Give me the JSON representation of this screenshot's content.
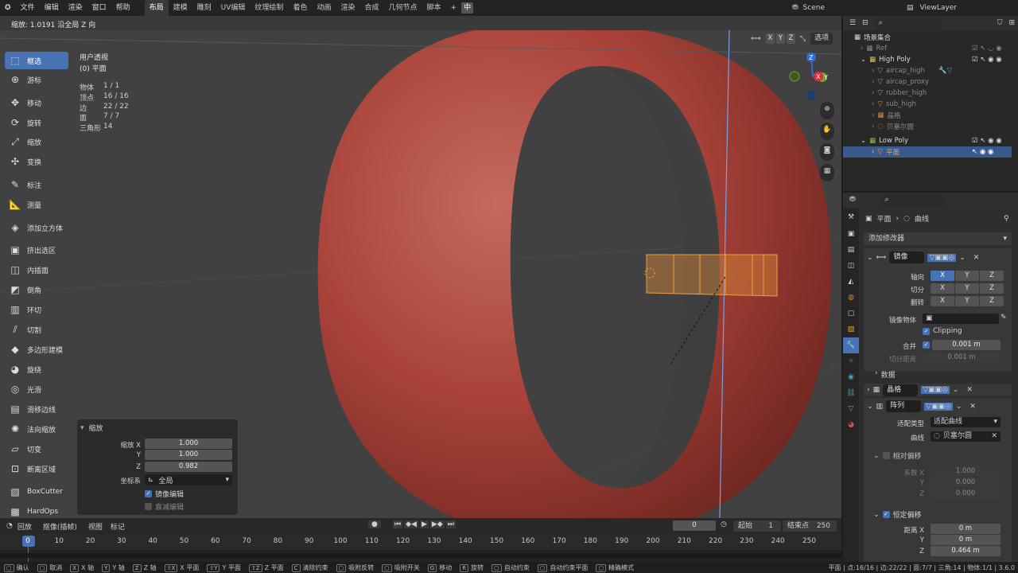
{
  "topbar": {
    "menus": [
      "文件",
      "编辑",
      "渲染",
      "窗口",
      "帮助"
    ],
    "workspaces": [
      "布局",
      "建模",
      "雕刻",
      "UV编辑",
      "纹理绘制",
      "着色",
      "动画",
      "渲染",
      "合成",
      "几何节点",
      "脚本"
    ],
    "active_workspace": "布局",
    "lang_button": "中",
    "scene_label": "Scene",
    "viewlayer_label": "ViewLayer"
  },
  "header": {
    "status_text": "缩放: 1.0191 沿全局 Z 向"
  },
  "viewport": {
    "view_name": "用户透视",
    "object_name": "(0) 平面",
    "stats": [
      {
        "k": "物体",
        "v": "1 / 1"
      },
      {
        "k": "顶点",
        "v": "16 / 16"
      },
      {
        "k": "边",
        "v": "22 / 22"
      },
      {
        "k": "面",
        "v": "7 / 7"
      },
      {
        "k": "三角形",
        "v": "14"
      }
    ],
    "xyz": [
      "X",
      "Y",
      "Z"
    ],
    "options_label": "选项",
    "gizmo": {
      "z": "Z",
      "x": "X",
      "y": "Y"
    }
  },
  "tools": [
    "框选",
    "游标",
    "移动",
    "旋转",
    "缩放",
    "变换",
    "标注",
    "测量",
    "添加立方体",
    "挤出选区",
    "内插面",
    "倒角",
    "环切",
    "切割",
    "多边形建模",
    "旋绕",
    "光滑",
    "滑移边线",
    "法向缩放",
    "切变",
    "断离区域",
    "BoxCutter",
    "HardOps"
  ],
  "redo_panel": {
    "title": "缩放",
    "rows": [
      {
        "label": "缩放 X",
        "value": "1.000"
      },
      {
        "label": "Y",
        "value": "1.000"
      },
      {
        "label": "Z",
        "value": "0.982"
      }
    ],
    "coord_label": "坐标系",
    "coord_value": "全局",
    "mirror_edit": "镜像编辑",
    "proportional": "衰减编辑"
  },
  "outliner": {
    "root": "场景集合",
    "items": [
      {
        "name": "Ref",
        "level": 1
      },
      {
        "name": "High Poly",
        "level": 1
      },
      {
        "name": "aircap_high",
        "level": 2
      },
      {
        "name": "aircap_proxy",
        "level": 2
      },
      {
        "name": "rubber_high",
        "level": 2
      },
      {
        "name": "sub_high",
        "level": 2
      },
      {
        "name": "晶格",
        "level": 2
      },
      {
        "name": "贝塞尔圆",
        "level": 2
      },
      {
        "name": "Low Poly",
        "level": 1
      },
      {
        "name": "平面",
        "level": 2
      }
    ]
  },
  "properties": {
    "breadcrumb_obj": "平面",
    "breadcrumb_curve": "曲线",
    "add_modifier": "添加修改器",
    "mirror": {
      "name": "镜像",
      "axis_label": "轴向",
      "bisect_label": "切分",
      "flip_label": "翻转",
      "axes": [
        "X",
        "Y",
        "Z"
      ],
      "mirror_object_label": "镜像物体",
      "clipping_label": "Clipping",
      "merge_label": "合并",
      "merge_value": "0.001 m",
      "bisect_dist_label": "切分距离",
      "bisect_dist_value": "0.001 m",
      "data_label": "数据"
    },
    "lattice": {
      "name": "晶格"
    },
    "array": {
      "name": "阵列",
      "fit_type_label": "适配类型",
      "fit_type_value": "适配曲线",
      "curve_label": "曲线",
      "curve_value": "贝塞尔圆",
      "relative_label": "相对偏移",
      "factor_label": "系数 X",
      "factor_x": "1.000",
      "factor_y": "0.000",
      "factor_z": "0.000",
      "constant_label": "恒定偏移",
      "dist_label": "距离 X",
      "dist_x": "0 m",
      "dist_y": "0 m",
      "dist_z": "0.464 m"
    }
  },
  "timeline": {
    "menus": [
      "回放",
      "抠像(插帧)",
      "视图",
      "标记"
    ],
    "current_frame": "0",
    "start_label": "起始",
    "start": "1",
    "end_label": "结束点",
    "end": "250",
    "ticks": [
      "0",
      "10",
      "20",
      "30",
      "40",
      "50",
      "60",
      "70",
      "80",
      "90",
      "100",
      "110",
      "120",
      "130",
      "140",
      "150",
      "160",
      "170",
      "180",
      "190",
      "200",
      "210",
      "220",
      "230",
      "240",
      "250"
    ]
  },
  "statusbar": {
    "items": [
      "确认",
      "取消",
      "X 轴",
      "Y 轴",
      "Z 轴",
      "X 平面",
      "Y 平面",
      "Z 平面",
      "清除约束",
      "吸附反转",
      "吸附开关",
      "移动",
      "旋转",
      "自动约束",
      "自动约束平面",
      "精确模式"
    ],
    "keys": [
      "",
      "",
      "X",
      "Y",
      "Z",
      "⇧X",
      "⇧Y",
      "⇧Z",
      "C",
      "",
      "",
      "G",
      "R",
      "",
      "",
      ""
    ],
    "right": "平面 | 点:16/16 | 边:22/22 | 面:7/7 | 三角:14 | 物体:1/1 | 3.6.0"
  }
}
